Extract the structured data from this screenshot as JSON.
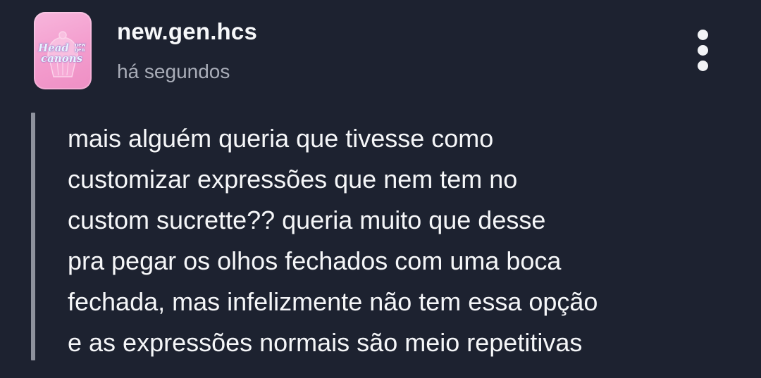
{
  "post": {
    "author": {
      "username": "new.gen.hcs",
      "avatar_logo": {
        "line1": "Head",
        "line2": "canons",
        "small": "new gen"
      }
    },
    "timestamp": "há segundos",
    "more_icon": "more-vertical-icon",
    "quote_lines": [
      "mais alguém queria que tivesse como",
      "customizar expressões que nem tem no",
      "custom sucrette?? queria muito que desse",
      "pra pegar os olhos fechados com uma boca",
      "fechada, mas infelizmente não tem essa opção",
      "e as expressões normais são meio repetitivas"
    ]
  },
  "colors": {
    "background": "#1d2230",
    "avatar_pink": "#f39ccd",
    "quote_bar": "#8e929d",
    "timestamp": "#a9adb8"
  }
}
